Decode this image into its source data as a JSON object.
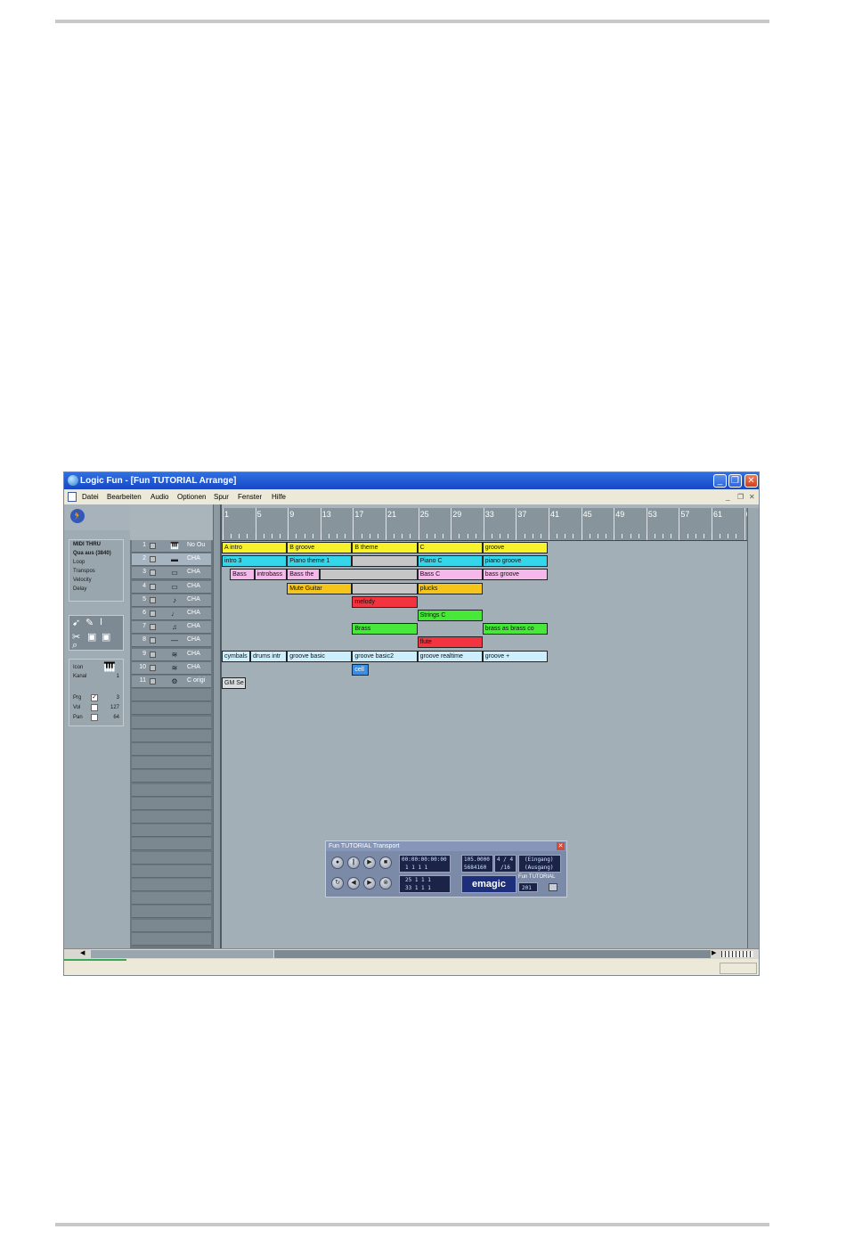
{
  "window": {
    "title": "Logic Fun - [Fun TUTORIAL Arrange]",
    "controls": {
      "minimize": "_",
      "restore": "❐",
      "close": "✕"
    }
  },
  "menubar": {
    "items": [
      "Datei",
      "Bearbeiten",
      "Audio",
      "Optionen",
      "Spur",
      "Fenster",
      "Hilfe"
    ],
    "right_controls": [
      "_",
      "❐",
      "✕"
    ]
  },
  "inspector": {
    "midi_box": {
      "title": "MIDI THRU",
      "lines": [
        "Qua  aus (3840)",
        "Loop",
        "Transpos",
        "Velocity",
        "Delay"
      ]
    },
    "instrument_box": {
      "icon_label": "Icon",
      "channel_label": "Kanal",
      "channel_value": "1",
      "prg_label": "Prg",
      "prg_value": "3",
      "vol_label": "Vol",
      "vol_value": "127",
      "pan_label": "Pan",
      "pan_value": "64"
    }
  },
  "ruler": {
    "bars": [
      "1",
      "5",
      "9",
      "13",
      "17",
      "21",
      "25",
      "29",
      "33",
      "37",
      "41",
      "45",
      "49",
      "53",
      "57",
      "61",
      "6"
    ]
  },
  "tracks": [
    {
      "num": "1",
      "name": "No Ou",
      "icon": "🎹"
    },
    {
      "num": "2",
      "name": "CHA  ",
      "icon": "▬"
    },
    {
      "num": "3",
      "name": "CHA  ",
      "icon": "▭"
    },
    {
      "num": "4",
      "name": "CHA  ",
      "icon": "▭"
    },
    {
      "num": "5",
      "name": "CHA  ",
      "icon": "♪"
    },
    {
      "num": "6",
      "name": "CHA  ",
      "icon": "♩"
    },
    {
      "num": "7",
      "name": "CHA  ",
      "icon": "♫"
    },
    {
      "num": "8",
      "name": "CHA  ",
      "icon": "—"
    },
    {
      "num": "9",
      "name": "CHA  ",
      "icon": "≋"
    },
    {
      "num": "10",
      "name": "CHA  ",
      "icon": "≋"
    },
    {
      "num": "11",
      "name": "C origi",
      "icon": "⚙"
    }
  ],
  "regions": [
    {
      "label": "A intro",
      "row": 0,
      "start": 1,
      "len": 8,
      "color": "#f7f22a"
    },
    {
      "label": "B groove",
      "row": 0,
      "start": 9,
      "len": 8,
      "color": "#f7f22a"
    },
    {
      "label": "B theme",
      "row": 0,
      "start": 17,
      "len": 8,
      "color": "#f7f22a"
    },
    {
      "label": "C",
      "row": 0,
      "start": 25,
      "len": 8,
      "color": "#f7f22a"
    },
    {
      "label": "groove",
      "row": 0,
      "start": 33,
      "len": 8,
      "color": "#f7f22a"
    },
    {
      "label": "intro 3",
      "row": 1,
      "start": 1,
      "len": 8,
      "color": "#36d6ea"
    },
    {
      "label": "Piano theme 1",
      "row": 1,
      "start": 9,
      "len": 8,
      "color": "#36d6ea"
    },
    {
      "label": "",
      "row": 1,
      "start": 17,
      "len": 8,
      "color": "#c6c6c6"
    },
    {
      "label": "Piano C",
      "row": 1,
      "start": 25,
      "len": 8,
      "color": "#36d6ea"
    },
    {
      "label": "piano groove",
      "row": 1,
      "start": 33,
      "len": 8,
      "color": "#36d6ea"
    },
    {
      "label": "Bass",
      "row": 2,
      "start": 2,
      "len": 3,
      "color": "#f6b7ea"
    },
    {
      "label": "introbass",
      "row": 2,
      "start": 5,
      "len": 4,
      "color": "#f6b7ea"
    },
    {
      "label": "Bass the",
      "row": 2,
      "start": 9,
      "len": 4,
      "color": "#f6b7ea"
    },
    {
      "label": "",
      "row": 2,
      "start": 13,
      "len": 12,
      "color": "#c6c6c6"
    },
    {
      "label": "Bass C",
      "row": 2,
      "start": 25,
      "len": 8,
      "color": "#f6b7ea"
    },
    {
      "label": "bass groove",
      "row": 2,
      "start": 33,
      "len": 8,
      "color": "#f6b7ea"
    },
    {
      "label": "Mute Guitar",
      "row": 3,
      "start": 9,
      "len": 8,
      "color": "#f6c51a"
    },
    {
      "label": "",
      "row": 3,
      "start": 17,
      "len": 8,
      "color": "#c6c6c6"
    },
    {
      "label": "plucks",
      "row": 3,
      "start": 25,
      "len": 8,
      "color": "#f6c51a"
    },
    {
      "label": "melody",
      "row": 4,
      "start": 17,
      "len": 8,
      "color": "#f1343f"
    },
    {
      "label": "Strings C",
      "row": 5,
      "start": 25,
      "len": 8,
      "color": "#48e83a"
    },
    {
      "label": "Brass",
      "row": 6,
      "start": 17,
      "len": 8,
      "color": "#48e83a"
    },
    {
      "label": "brass as brass co",
      "row": 6,
      "start": 33,
      "len": 8,
      "color": "#48e83a"
    },
    {
      "label": "flute",
      "row": 7,
      "start": 25,
      "len": 8,
      "color": "#f1343f"
    },
    {
      "label": "cymbals",
      "row": 8,
      "start": 1,
      "len": 3.5,
      "color": "#cdeefc"
    },
    {
      "label": "drums intr",
      "row": 8,
      "start": 4.5,
      "len": 4.5,
      "color": "#cdeefc"
    },
    {
      "label": "groove basic",
      "row": 8,
      "start": 9,
      "len": 8,
      "color": "#cdeefc"
    },
    {
      "label": "groove basic2",
      "row": 8,
      "start": 17,
      "len": 8,
      "color": "#cdeefc"
    },
    {
      "label": "groove realtime",
      "row": 8,
      "start": 25,
      "len": 8,
      "color": "#cdeefc"
    },
    {
      "label": "groove +",
      "row": 8,
      "start": 33,
      "len": 8,
      "color": "#cdeefc"
    },
    {
      "label": "cell",
      "row": 9,
      "start": 17,
      "len": 2,
      "color": "#3d8ee0"
    },
    {
      "label": "GM Se",
      "row": 10,
      "start": 1,
      "len": 3,
      "color": "#d8dcdf"
    }
  ],
  "transport": {
    "title": "Fun TUTORIAL Transport",
    "close": "✕",
    "smpte": "00:00:00:00:00",
    "position": "1   1   1     1",
    "tempo": "105.0000",
    "sample": "5684160",
    "signature": "4 /  4",
    "division": "/16",
    "left_locator": "25   1   1     1",
    "right_locator": "33   1   1     1",
    "in_label": "(Eingang)",
    "out_label": "(Ausgang)",
    "song_name": "Fun TUTORIAL",
    "song_value": "201",
    "logo": "emagic"
  }
}
